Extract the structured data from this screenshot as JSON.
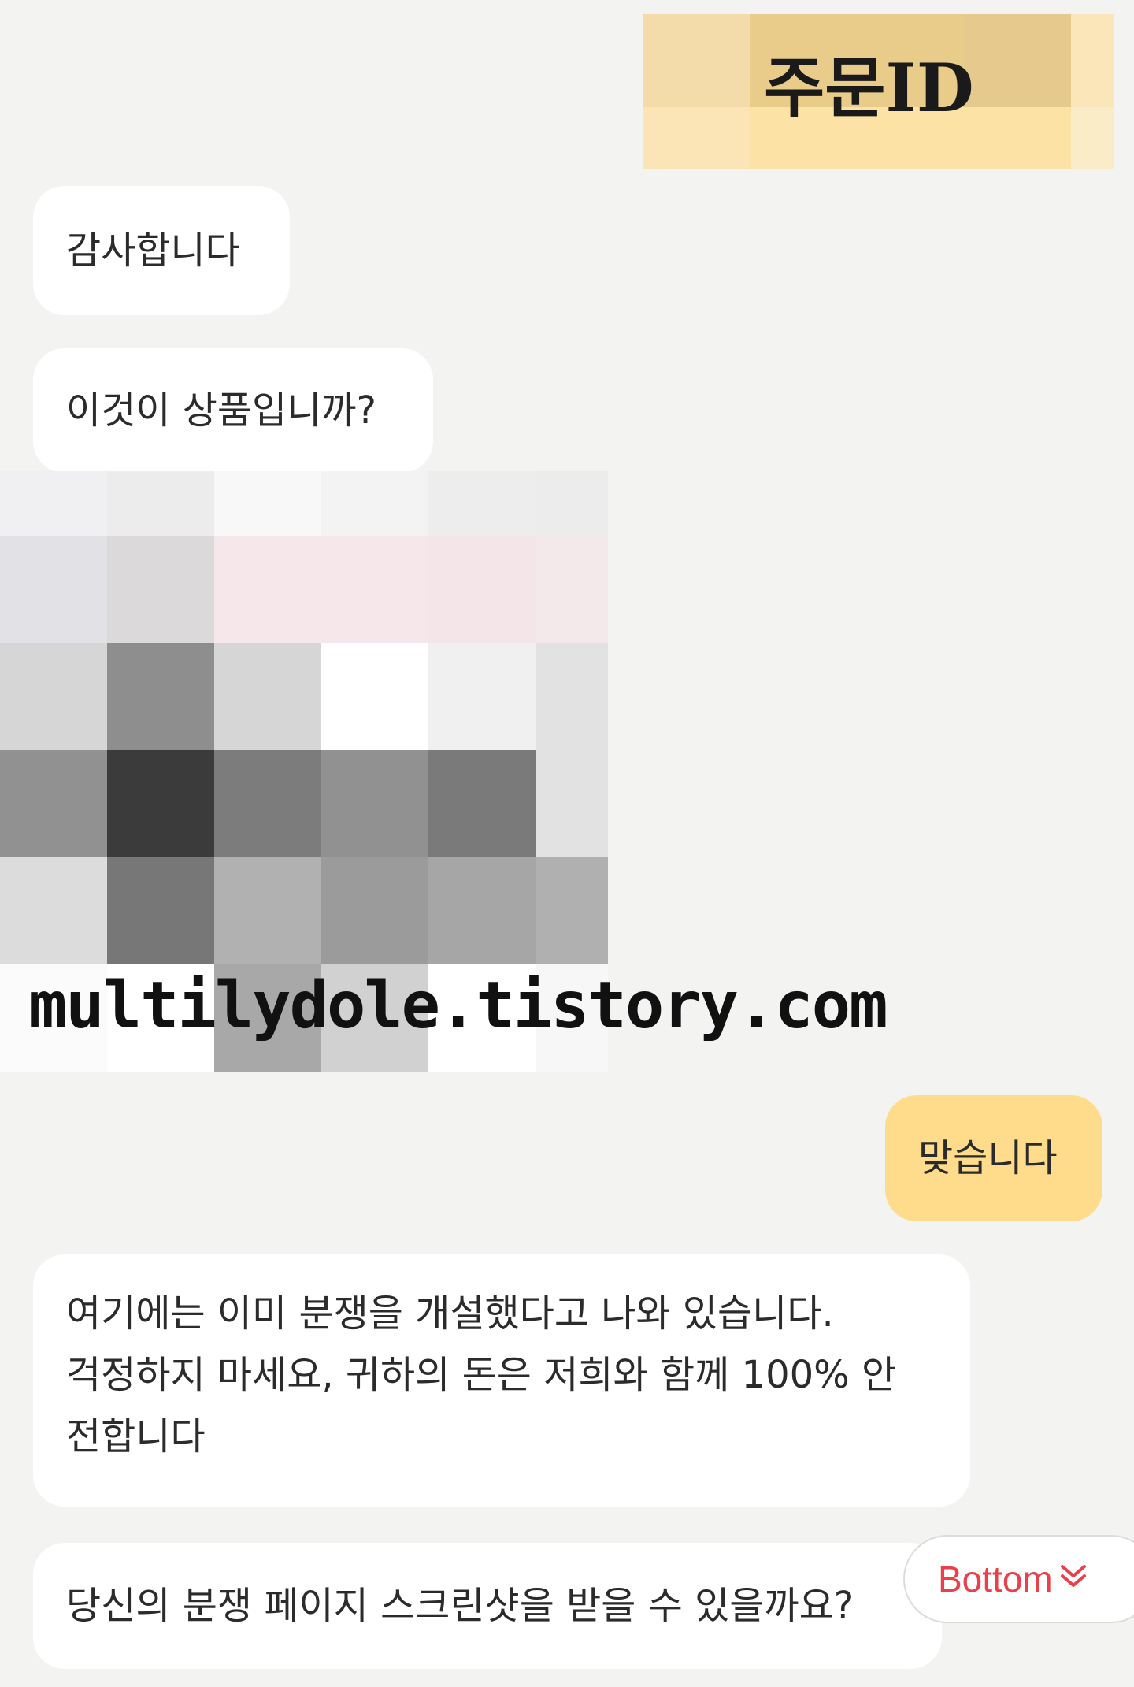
{
  "colors": {
    "background": "#f3f3f2",
    "incoming_bubble": "#ffffff",
    "outgoing_bubble": "#fedc8c",
    "bottom_button_text": "#e8414b"
  },
  "order_id_label": "주문ID",
  "watermark": "multilydole.tistory.com",
  "messages": [
    {
      "side": "incoming",
      "text": "감사합니다"
    },
    {
      "side": "incoming",
      "text": "이것이 상품입니까?"
    },
    {
      "side": "outgoing",
      "text": "맞습니다"
    },
    {
      "side": "incoming",
      "lines": [
        "여기에는 이미 분쟁을 개설했다고 나와 있습니다.",
        "걱정하지 마세요, 귀하의 돈은 저희와 함께 100% 안",
        "전합니다"
      ]
    },
    {
      "side": "incoming",
      "text": "당신의 분쟁 페이지 스크린샷을 받을 수 있을까요?"
    }
  ],
  "bottom_button": {
    "label": "Bottom",
    "icon": "double-chevron-down-icon"
  },
  "mosaics": {
    "order_id": [
      "#f3dca9",
      "#e9cb8a",
      "#e9cb8a",
      "#e6c98c",
      "#fae6b8",
      "#fbe5b6",
      "#fce3a5",
      "#fce3a5",
      "#fce3a5",
      "#fbecc8"
    ],
    "product": [
      "#f0f0f2",
      "#ececec",
      "#f8f8f8",
      "#f3f3f3",
      "#ededed",
      "#ececec",
      "#e2e2e6",
      "#dcd9da",
      "#f6e8ea",
      "#f6e8ea",
      "#f4e6e8",
      "#f4e9ea",
      "#d6d6d6",
      "#8e8e8e",
      "#d6d6d6",
      "#ffffff",
      "#f0f0f0",
      "#e2e2e2",
      "#919191",
      "#3b3b3b",
      "#7c7c7c",
      "#919191",
      "#7a7a7a",
      "#e2e2e2",
      "#dcdcdc",
      "#777777",
      "#b1b1b1",
      "#9b9b9b",
      "#a6a6a6",
      "#b0b0b0",
      "#fbfbfb",
      "#ffffff",
      "#a8a8a8",
      "#d1d1d1",
      "#ffffff",
      "#f7f7f7"
    ]
  }
}
